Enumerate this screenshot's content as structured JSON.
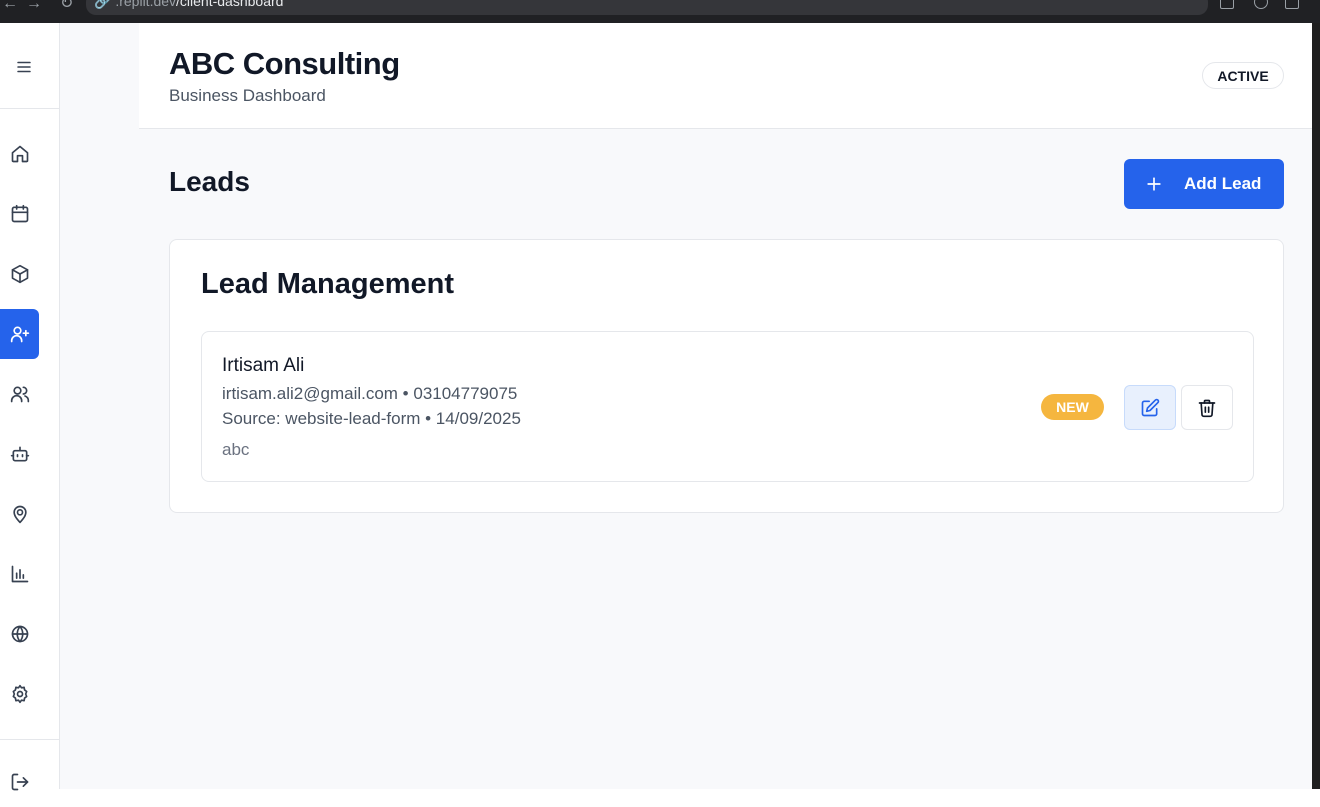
{
  "browser": {
    "url_prefix": ".replit.dev",
    "url_path": "/client-dashboard"
  },
  "sidebar": {
    "menu_icon": "hamburger-menu-icon",
    "items": [
      {
        "icon": "home-icon",
        "active": false
      },
      {
        "icon": "calendar-icon",
        "active": false
      },
      {
        "icon": "package-icon",
        "active": false
      },
      {
        "icon": "user-plus-icon",
        "active": true
      },
      {
        "icon": "users-icon",
        "active": false
      },
      {
        "icon": "bot-icon",
        "active": false
      },
      {
        "icon": "map-pin-icon",
        "active": false
      },
      {
        "icon": "bar-chart-icon",
        "active": false
      },
      {
        "icon": "globe-icon",
        "active": false
      },
      {
        "icon": "settings-icon",
        "active": false
      }
    ],
    "logout_icon": "logout-icon"
  },
  "header": {
    "title": "ABC Consulting",
    "subtitle": "Business Dashboard",
    "status": "ACTIVE"
  },
  "main": {
    "page_title": "Leads",
    "add_button_label": "Add Lead",
    "card_title": "Lead Management",
    "leads": [
      {
        "name": "Irtisam Ali",
        "contact": "irtisam.ali2@gmail.com • 03104779075",
        "source_line": "Source: website-lead-form • 14/09/2025",
        "notes": "abc",
        "status": "NEW"
      }
    ]
  },
  "colors": {
    "accent": "#2563eb",
    "status_new": "#f5b63f",
    "page_background": "#f8f9fb"
  }
}
